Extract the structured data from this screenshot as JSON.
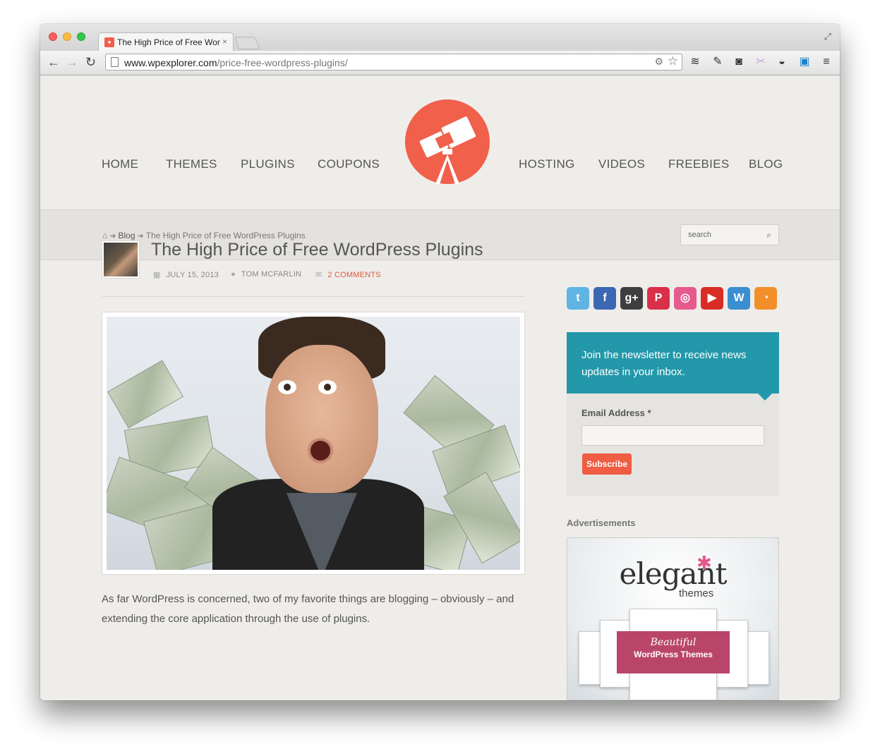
{
  "browser": {
    "tab_title": "The High Price of Free Wor",
    "tab_close": "×",
    "url_domain": "www.wpexplorer.com",
    "url_path": "/price-free-wordpress-plugins/"
  },
  "nav": {
    "left": [
      "HOME",
      "THEMES",
      "PLUGINS",
      "COUPONS"
    ],
    "right": [
      "HOSTING",
      "VIDEOS",
      "FREEBIES",
      "BLOG"
    ]
  },
  "breadcrumb": {
    "blog": "Blog",
    "current": "The High Price of Free WordPress Plugins"
  },
  "search": {
    "placeholder": "search"
  },
  "post": {
    "title": "The High Price of Free WordPress Plugins",
    "date": "JULY 15, 2013",
    "author": "TOM MCFARLIN",
    "comments": "2 COMMENTS",
    "body": "As far WordPress is concerned, two of my favorite things are blogging – obviously – and extending the core application through the use of plugins."
  },
  "sidebar": {
    "social_icons": [
      "twitter-icon",
      "facebook-icon",
      "google-plus-icon",
      "pinterest-icon",
      "dribbble-icon",
      "youtube-icon",
      "wordpress-icon",
      "rss-icon"
    ],
    "newsletter": {
      "heading": "Join the newsletter to receive news updates in your inbox.",
      "email_label": "Email Address *",
      "button": "Subscribe"
    },
    "ads_label": "Advertisements",
    "ad": {
      "brand": "elegant",
      "sub": "themes",
      "ribbon_line1": "Beautiful",
      "ribbon_line2": "WordPress Themes"
    }
  },
  "colors": {
    "accent": "#f0604b",
    "newsletter": "#2398aa",
    "link": "#e4573e"
  }
}
